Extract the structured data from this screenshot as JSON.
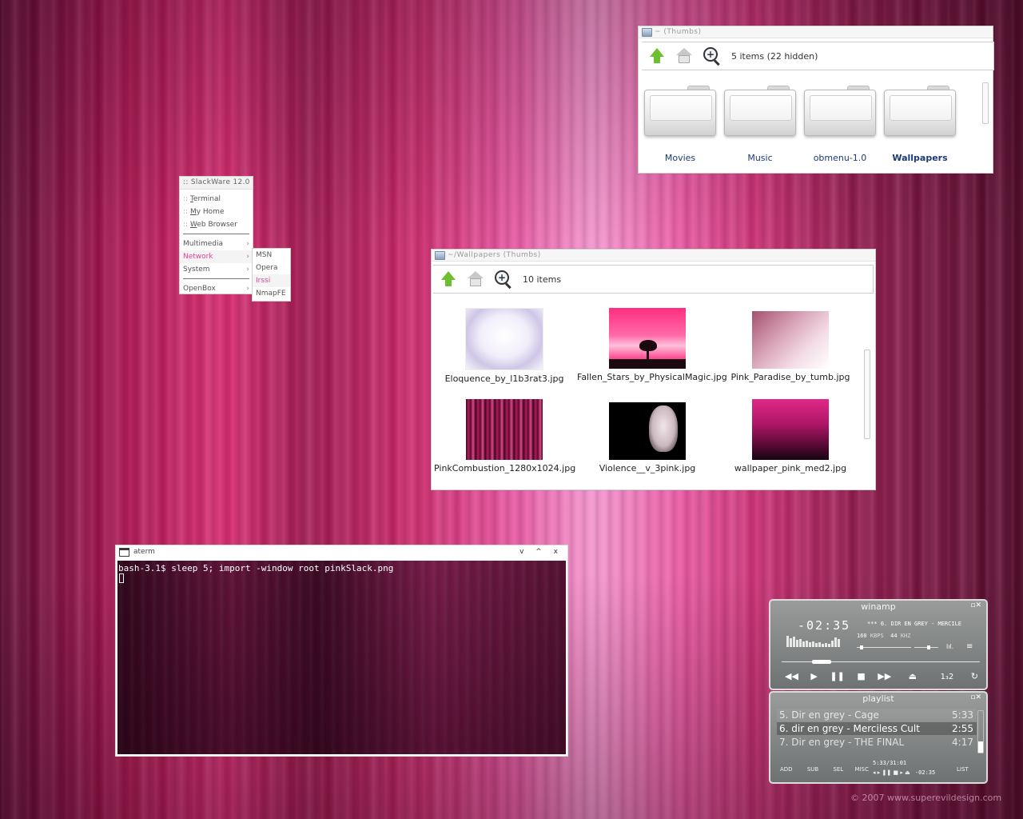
{
  "thumbs_window": {
    "title": "~ (Thumbs)",
    "status": "5 items (22 hidden)",
    "folders": [
      {
        "label": "Movies",
        "bold": false
      },
      {
        "label": "Music",
        "bold": false
      },
      {
        "label": "obmenu-1.0",
        "bold": false
      },
      {
        "label": "Wallpapers",
        "bold": true
      }
    ]
  },
  "wallpapers_window": {
    "title": "~/Wallpapers (Thumbs)",
    "status": "10 items",
    "files": [
      {
        "name": "Eloquence_by_l1b3rat3.jpg"
      },
      {
        "name": "Fallen_Stars_by_PhysicalMagic.jpg"
      },
      {
        "name": "Pink_Paradise_by_tumb.jpg"
      },
      {
        "name": "PinkCombustion_1280x1024.jpg"
      },
      {
        "name": "Violence__v_3pink.jpg"
      },
      {
        "name": "wallpaper_pink_med2.jpg"
      }
    ]
  },
  "menu": {
    "title": ":: SlackWare 12.0",
    "prefix": "::",
    "items": [
      {
        "label_first": "T",
        "label_rest": "erminal"
      },
      {
        "label_first": "M",
        "label_rest": "y Home"
      },
      {
        "label_first": "W",
        "label_rest": "eb Browser"
      }
    ],
    "submenus": [
      {
        "label": "Multimedia",
        "arrow": "›"
      },
      {
        "label": "Network",
        "arrow": "›"
      },
      {
        "label": "System",
        "arrow": "›"
      },
      {
        "label": "OpenBox",
        "arrow": "›"
      }
    ],
    "network_items": [
      "MSN",
      "Opera",
      "Irssi",
      "NmapFE"
    ]
  },
  "aterm": {
    "title": "aterm",
    "controls": "v ^ x",
    "prompt_line": "bash-3.1$ sleep 5; import -window root pinkSlack.png"
  },
  "winamp": {
    "title": "winamp",
    "time": "-02:35",
    "track_marquee": "*** 6. DIR EN GREY - MERCILE",
    "kbps": "160",
    "kbps_unit": "KBPS",
    "khz": "44",
    "khz_unit": "KHZ",
    "shuffle_label": "1₃2",
    "position_fraction": 0.17,
    "volume_fraction": 0.06,
    "balance_fraction": 0.6
  },
  "playlist": {
    "title": "playlist",
    "rows": [
      {
        "title": "5. Dir en grey - Cage",
        "duration": "5:33"
      },
      {
        "title": "6. dir en grey - Merciless Cult",
        "duration": "2:55"
      },
      {
        "title": "7. Dir en grey - THE FINAL",
        "duration": "4:17"
      }
    ],
    "buttons": [
      "ADD",
      "SUB",
      "SEL",
      "MISC",
      "LIST"
    ],
    "total_time": "5:33/31:01",
    "remaining": "-02:35"
  },
  "watermark": "© 2007 www.superevildesign.com",
  "colors": {
    "menu_active": "#e0449a",
    "folder_label": "#1a3a7a",
    "winamp_body": "#7f8282"
  }
}
